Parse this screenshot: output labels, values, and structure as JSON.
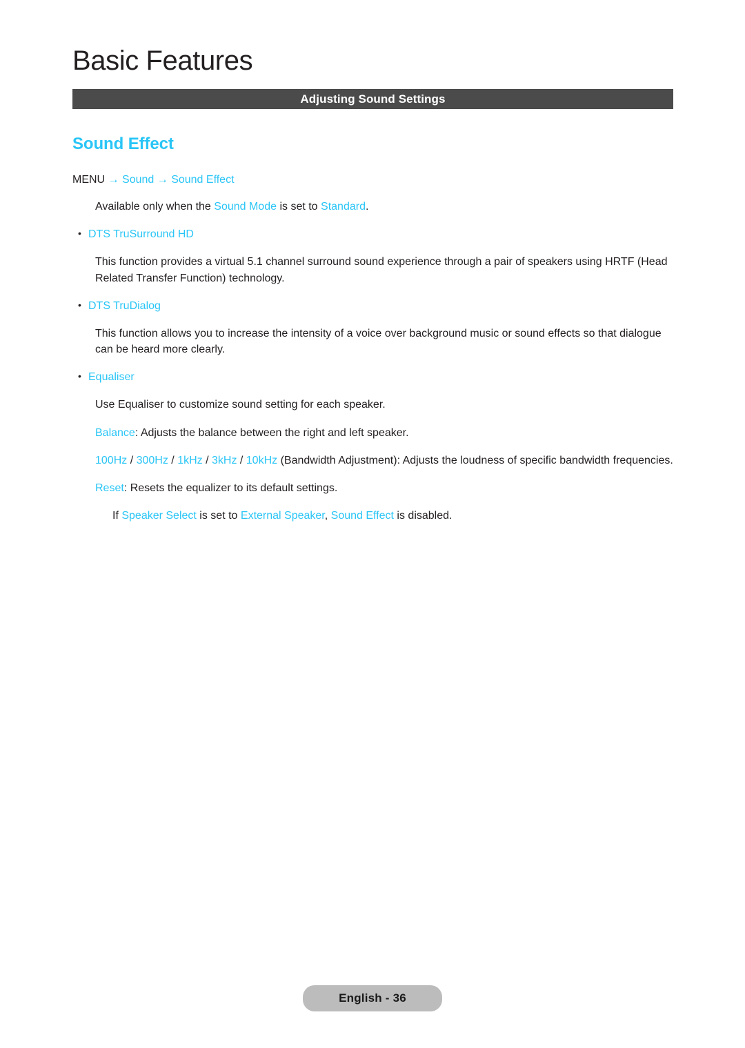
{
  "header": {
    "chapter_title": "Basic Features",
    "section_bar_label": "Adjusting Sound Settings",
    "section_bar_color": "#4b4b4b"
  },
  "theme": {
    "accent_color": "#29c5f6",
    "text_color": "#231f20",
    "badge_color": "#bcbcbc"
  },
  "content": {
    "topic_title": "Sound Effect",
    "menu_path": {
      "root": "MENU",
      "arrow": "→",
      "level1": "Sound",
      "level2": "Sound Effect"
    },
    "availability": {
      "pre": "Available only when the ",
      "term1": "Sound Mode",
      "mid": " is set to ",
      "term2": "Standard",
      "post": "."
    },
    "items": [
      {
        "bullet": "•",
        "label": "DTS TruSurround HD",
        "body": "This function provides a virtual 5.1 channel surround sound experience through a pair of speakers using HRTF (Head Related Transfer Function) technology."
      },
      {
        "bullet": "•",
        "label": "DTS TruDialog",
        "body": "This function allows you to increase the intensity of a voice over background music or sound effects so that dialogue can be heard more clearly."
      },
      {
        "bullet": "•",
        "label": "Equaliser",
        "body": "Use Equaliser to customize sound setting for each speaker."
      }
    ],
    "equaliser_settings": {
      "balance": {
        "term": "Balance",
        "text": ": Adjusts the balance between the right and left speaker."
      },
      "bandwidth": {
        "freq1": "100Hz",
        "sep1": " / ",
        "freq2": "300Hz",
        "sep2": " / ",
        "freq3": "1kHz",
        "sep3": " / ",
        "freq4": "3kHz",
        "sep4": " / ",
        "freq5": "10kHz",
        "text": " (Bandwidth Adjustment): Adjusts the loudness of specific bandwidth frequencies."
      },
      "reset": {
        "term": "Reset",
        "text": ": Resets the equalizer to its default settings."
      }
    },
    "note": {
      "pre": "If ",
      "term1": "Speaker Select",
      "mid1": " is set to ",
      "term2": "External Speaker",
      "mid2": ", ",
      "term3": "Sound Effect",
      "post": " is disabled."
    }
  },
  "footer": {
    "page_label": "English - 36"
  }
}
